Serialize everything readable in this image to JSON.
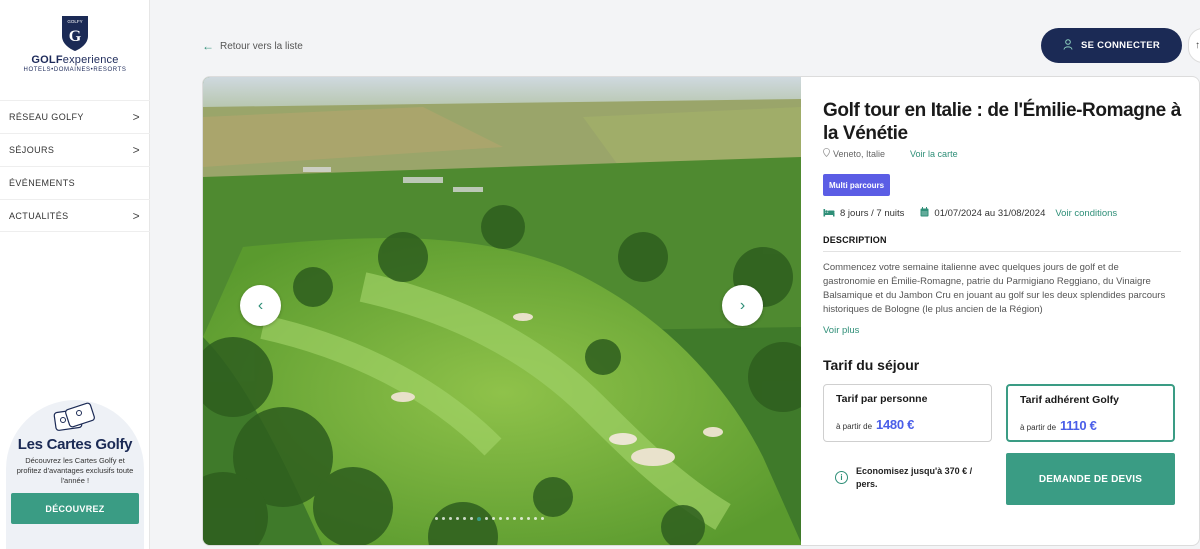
{
  "brand": {
    "shield_text": "GOLFY",
    "shield_letter": "G",
    "name_bold": "GOLF",
    "name_light": "experience",
    "tagline": "HOTELS•DOMAINES•RESORTS"
  },
  "sidebar": {
    "items": [
      {
        "label": "RÉSEAU GOLFY",
        "chevron": ">"
      },
      {
        "label": "SÉJOURS",
        "chevron": ">"
      },
      {
        "label": "ÉVÉNEMENTS",
        "chevron": ""
      },
      {
        "label": "ACTUALITÉS",
        "chevron": ">"
      }
    ],
    "promo": {
      "title": "Les Cartes Golfy",
      "text": "Découvrez les Cartes Golfy et profitez d'avantages exclusifs toute l'année !",
      "button": "DÉCOUVREZ"
    }
  },
  "header": {
    "back_label": "Retour vers la liste",
    "back_icon": "←",
    "login_label": "SE CONNECTER",
    "edge_button": "↑"
  },
  "carousel": {
    "prev_icon": "‹",
    "next_icon": "›",
    "slide_count": 16,
    "active_index": 6
  },
  "listing": {
    "title": "Golf tour en Italie : de l'Émilie-Romagne à la Vénétie",
    "location": "Veneto, Italie",
    "map_link": "Voir la carte",
    "badge": "Multi parcours",
    "duration": "8 jours / 7 nuits",
    "dates": "01/07/2024 au 31/08/2024",
    "conditions_link": "Voir conditions",
    "description_heading": "DESCRIPTION",
    "description": "Commencez votre semaine italienne avec quelques jours de golf et de gastronomie en Émilie-Romagne, patrie du Parmigiano Reggiano, du Vinaigre Balsamique et du Jambon Cru en jouant au golf sur les deux splendides parcours historiques de Bologne (le plus ancien de la Région)",
    "more_link": "Voir plus",
    "tarif_title": "Tarif du séjour",
    "prices": [
      {
        "label": "Tarif par personne",
        "from": "à partir de",
        "amount": "1480 €"
      },
      {
        "label": "Tarif adhérent Golfy",
        "from": "à partir de",
        "amount": "1110 €"
      }
    ],
    "savings": "Economisez jusqu'à 370 € / pers.",
    "quote_button": "DEMANDE DE DEVIS"
  },
  "colors": {
    "navy": "#1b2a55",
    "green": "#3a9c84",
    "badge": "#5b5de5",
    "price": "#4a5ee8"
  }
}
